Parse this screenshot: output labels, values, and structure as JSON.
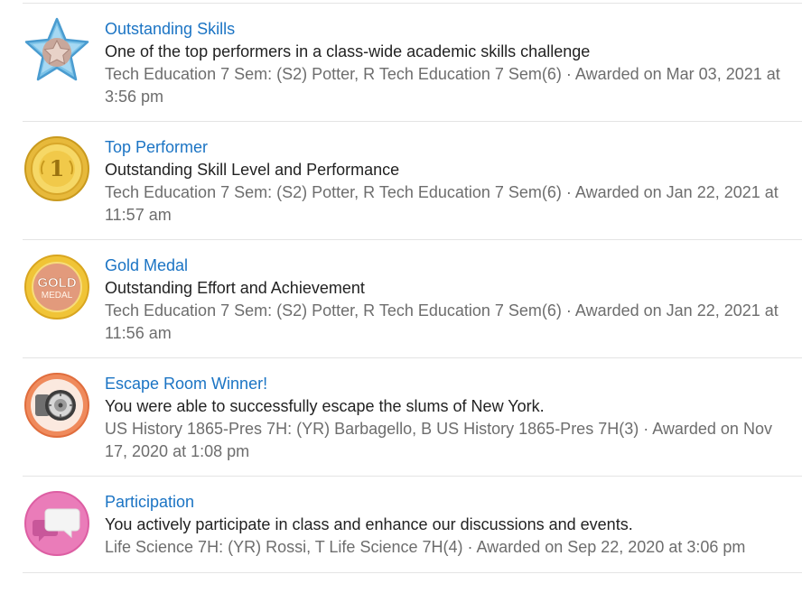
{
  "badges": [
    {
      "title": "Outstanding Skills",
      "description": "One of the top performers in a class-wide academic skills challenge",
      "meta": "Tech Education 7 Sem: (S2) Potter, R Tech Education 7 Sem(6) · Awarded on Mar 03, 2021 at 3:56 pm",
      "icon": "star-badge-icon"
    },
    {
      "title": "Top Performer",
      "description": "Outstanding Skill Level and Performance",
      "meta": "Tech Education 7 Sem: (S2) Potter, R Tech Education 7 Sem(6) · Awarded on Jan 22, 2021 at 11:57 am",
      "icon": "first-place-medal-icon",
      "icon_text": "1"
    },
    {
      "title": "Gold Medal",
      "description": "Outstanding Effort and Achievement",
      "meta": "Tech Education 7 Sem: (S2) Potter, R Tech Education 7 Sem(6) · Awarded on Jan 22, 2021 at 11:56 am",
      "icon": "gold-medal-icon",
      "icon_text": [
        "GOLD",
        "MEDAL"
      ]
    },
    {
      "title": "Escape Room Winner!",
      "description": "You were able to successfully escape the slums of New York.",
      "meta": "US History 1865-Pres 7H: (YR) Barbagello, B US History 1865-Pres 7H(3) · Awarded on Nov 17, 2020 at 1:08 pm",
      "icon": "combination-lock-icon"
    },
    {
      "title": "Participation",
      "description": "You actively participate in class and enhance our discussions and events.",
      "meta": "Life Science 7H: (YR) Rossi, T Life Science 7H(4) · Awarded on Sep 22, 2020 at 3:06 pm",
      "icon": "chat-bubbles-icon"
    }
  ],
  "colors": {
    "title_link": "#1b74c4",
    "description": "#222222",
    "meta": "#6d6d6d",
    "divider": "#e4e4e4"
  }
}
